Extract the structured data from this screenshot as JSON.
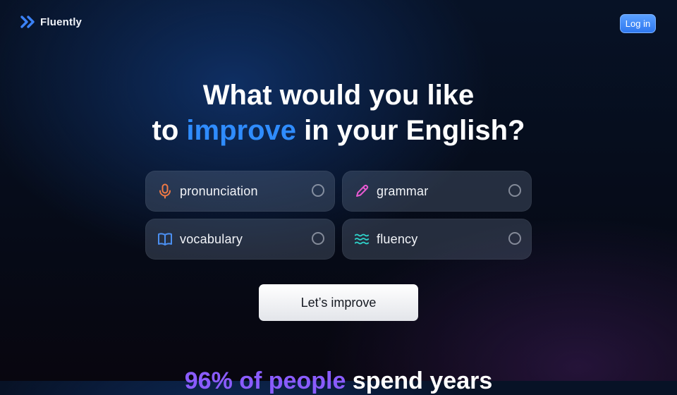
{
  "header": {
    "brand_name": "Fluently",
    "login_label": "Log in"
  },
  "hero": {
    "title_line1": "What would you like",
    "title_line2_pre": "to ",
    "title_line2_highlight": "improve",
    "title_line2_post": " in your English?"
  },
  "options": [
    {
      "label": "pronunciation",
      "icon": "microphone-icon",
      "icon_color": "#f07a45",
      "selected": false
    },
    {
      "label": "grammar",
      "icon": "pencil-icon",
      "icon_color": "#e85ad2",
      "selected": false
    },
    {
      "label": "vocabulary",
      "icon": "book-icon",
      "icon_color": "#4b8ff0",
      "selected": false
    },
    {
      "label": "fluency",
      "icon": "waves-icon",
      "icon_color": "#2fd0c8",
      "selected": false
    }
  ],
  "cta": {
    "label": "Let’s improve"
  },
  "teaser": {
    "highlight": "96% of people",
    "rest": " spend years"
  },
  "colors": {
    "accent_blue": "#2f8cff",
    "accent_purple": "#8a5cff",
    "login_bg": "#3a86f5"
  }
}
